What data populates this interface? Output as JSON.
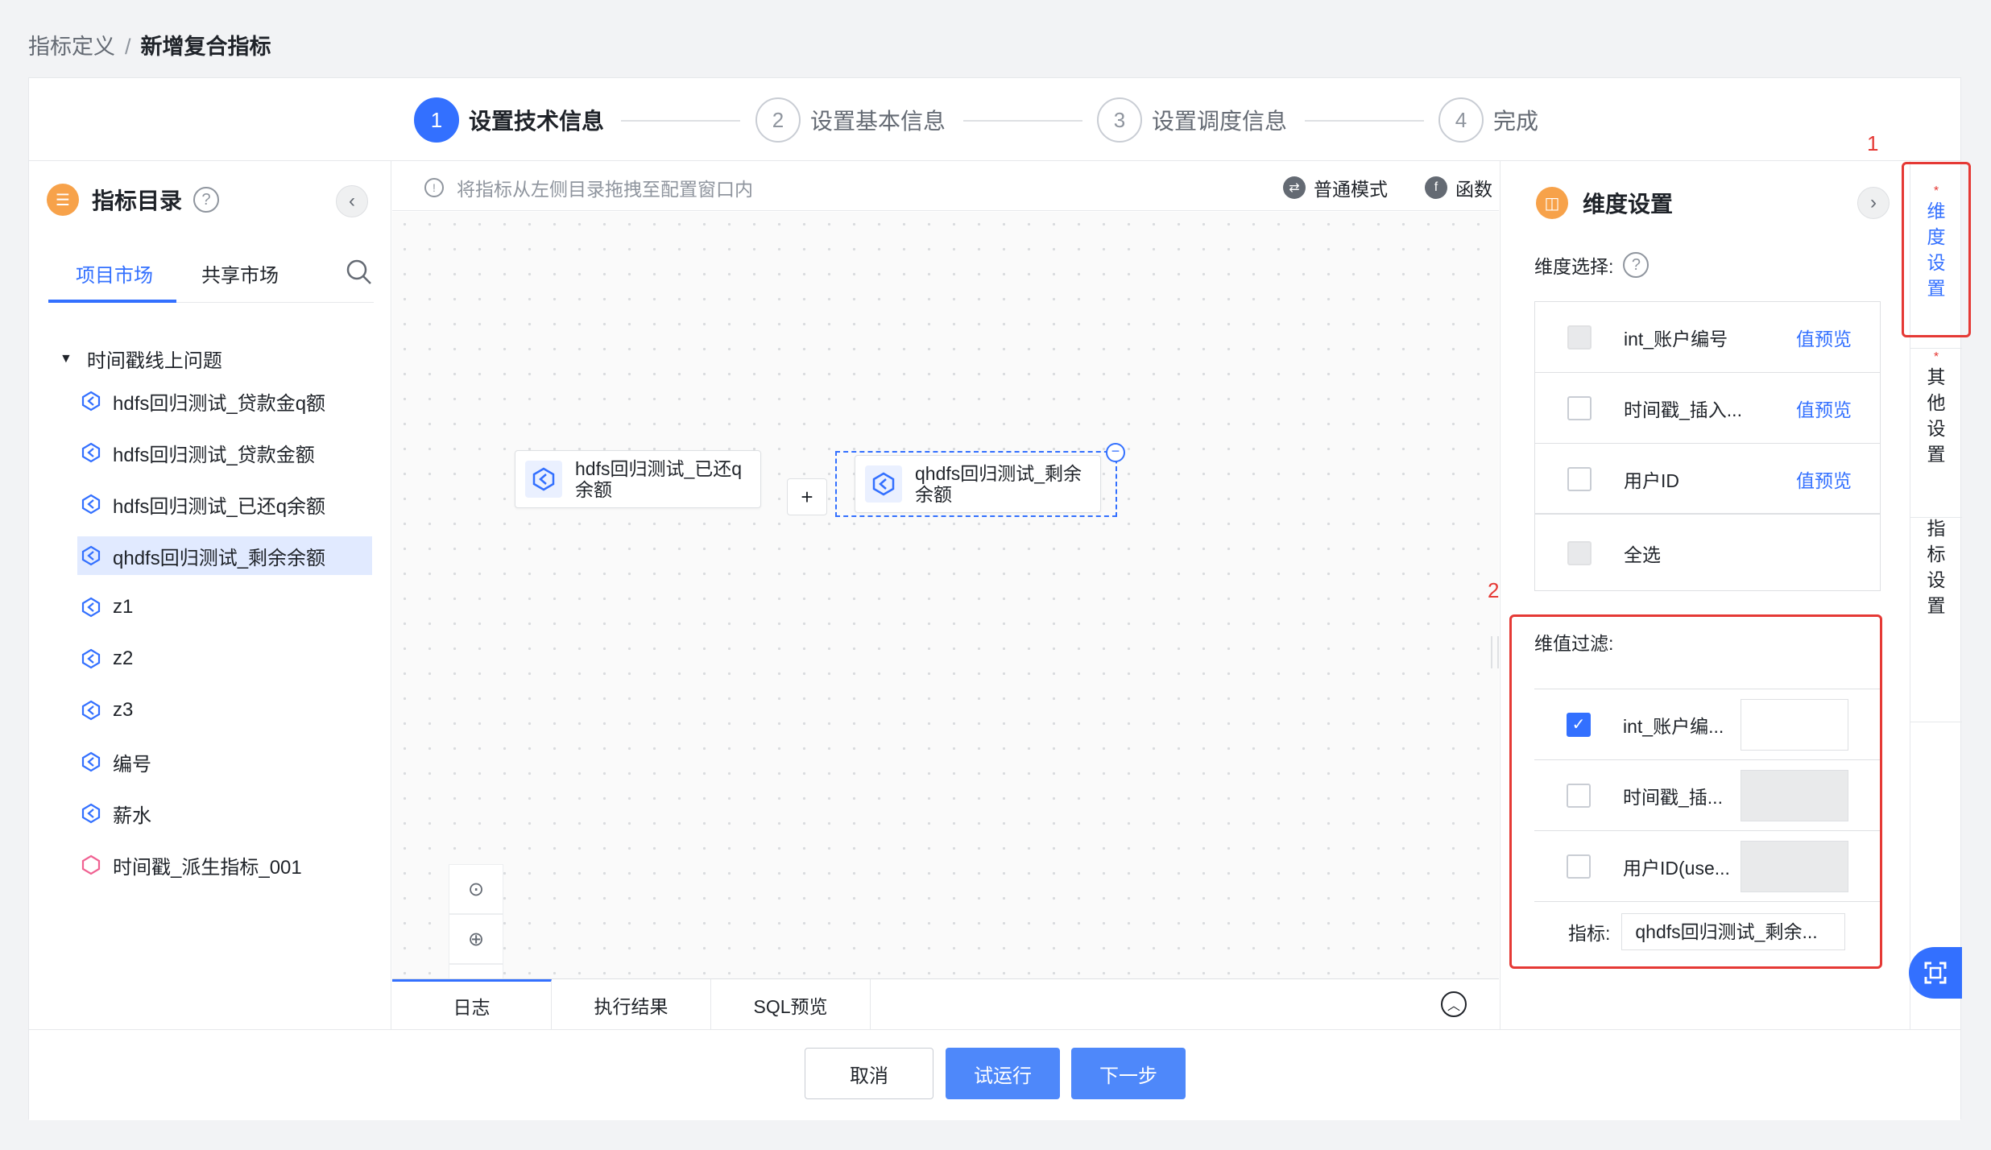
{
  "breadcrumb": {
    "parent": "指标定义",
    "separator": "/",
    "current": "新增复合指标"
  },
  "steps": [
    {
      "num": "1",
      "label": "设置技术信息",
      "active": true
    },
    {
      "num": "2",
      "label": "设置基本信息"
    },
    {
      "num": "3",
      "label": "设置调度信息"
    },
    {
      "num": "4",
      "label": "完成"
    }
  ],
  "left": {
    "title": "指标目录",
    "help": "?",
    "collapse": "‹",
    "tabs": [
      "项目市场",
      "共享市场"
    ],
    "tree_root": "时间戳线上问题",
    "items": [
      "hdfs回归测试_贷款金q额",
      "hdfs回归测试_贷款金额",
      "hdfs回归测试_已还q余额",
      "qhdfs回归测试_剩余余额",
      "z1",
      "z2",
      "z3",
      "编号",
      "薪水",
      "时间戳_派生指标_001"
    ]
  },
  "canvas": {
    "tip": "将指标从左侧目录拖拽至配置窗口内",
    "mode_normal": "普通模式",
    "mode_func": "函数",
    "node1": {
      "line1": "hdfs回归测试_已还q",
      "line2": "余额"
    },
    "plus": "+",
    "node2": {
      "line1": "qhdfs回归测试_剩余",
      "line2": "余额"
    },
    "bottom_tabs": [
      "日志",
      "执行结果",
      "SQL预览"
    ]
  },
  "right": {
    "title": "维度设置",
    "expand": "›",
    "dim_select_label": "维度选择:",
    "dims": [
      {
        "label": "int_账户编号",
        "link": "值预览",
        "state": "disabled"
      },
      {
        "label": "时间戳_插入...",
        "link": "值预览",
        "state": "unchecked"
      },
      {
        "label": "用户ID",
        "link": "值预览",
        "state": "unchecked"
      },
      {
        "label": "全选",
        "link": "",
        "state": "disabled"
      }
    ],
    "filter_label": "维值过滤:",
    "filters": [
      {
        "label": "int_账户编...",
        "checked": true
      },
      {
        "label": "时间戳_插...",
        "checked": false
      },
      {
        "label": "用户ID(use...",
        "checked": false
      }
    ],
    "metric_label": "指标:",
    "metric_value": "qhdfs回归测试_剩余...",
    "annot_1": "1",
    "annot_2": "2"
  },
  "side_tabs": [
    {
      "star": "*",
      "chars": [
        "维",
        "度",
        "设",
        "置"
      ],
      "active": true
    },
    {
      "star": "*",
      "chars": [
        "其",
        "他",
        "设",
        "置"
      ]
    },
    {
      "star": "",
      "chars": [
        "指",
        "标",
        "设",
        "置"
      ]
    }
  ],
  "footer": {
    "cancel": "取消",
    "trial": "试运行",
    "next": "下一步"
  }
}
